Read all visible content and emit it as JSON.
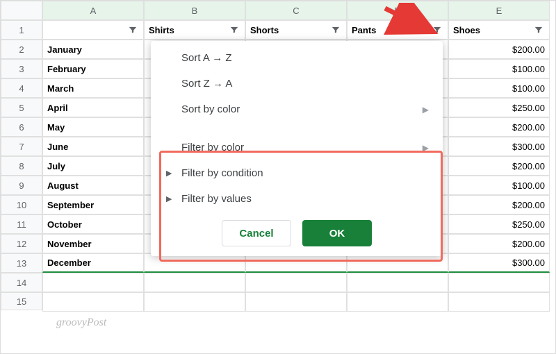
{
  "columns": [
    "A",
    "B",
    "C",
    "D",
    "E"
  ],
  "headers": {
    "B": "Shirts",
    "C": "Shorts",
    "D": "Pants",
    "E": "Shoes"
  },
  "selected_header_col": "D",
  "rows": [
    {
      "n": 1
    },
    {
      "n": 2,
      "month": "January",
      "shoes": "$200.00"
    },
    {
      "n": 3,
      "month": "February",
      "shoes": "$100.00"
    },
    {
      "n": 4,
      "month": "March",
      "shoes": "$100.00"
    },
    {
      "n": 5,
      "month": "April",
      "shoes": "$250.00"
    },
    {
      "n": 6,
      "month": "May",
      "shoes": "$200.00"
    },
    {
      "n": 7,
      "month": "June",
      "shoes": "$300.00"
    },
    {
      "n": 8,
      "month": "July",
      "shoes": "$200.00"
    },
    {
      "n": 9,
      "month": "August",
      "shoes": "$100.00"
    },
    {
      "n": 10,
      "month": "September",
      "shoes": "$200.00"
    },
    {
      "n": 11,
      "month": "October",
      "shoes": "$250.00"
    },
    {
      "n": 12,
      "month": "November",
      "shoes": "$200.00"
    },
    {
      "n": 13,
      "month": "December",
      "shoes": "$300.00"
    },
    {
      "n": 14
    },
    {
      "n": 15
    }
  ],
  "menu": {
    "sort_az": "Sort A → Z",
    "sort_za": "Sort Z → A",
    "sort_color": "Sort by color",
    "filter_color": "Filter by color",
    "filter_cond": "Filter by condition",
    "filter_val": "Filter by values",
    "cancel": "Cancel",
    "ok": "OK"
  },
  "watermark": "groovyPost"
}
